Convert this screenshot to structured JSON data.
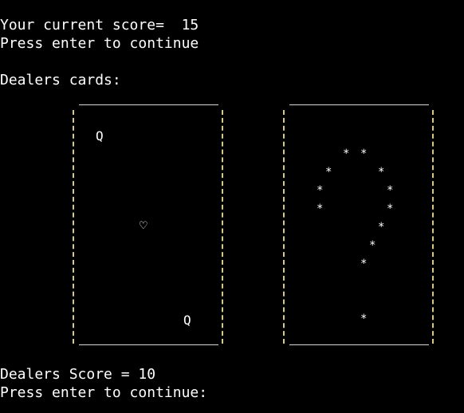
{
  "terminal": {
    "score_line": "Your current score=  15",
    "continue_prompt_1": "Press enter to continue",
    "dealers_cards_label": "Dealers cards:",
    "dealer_score_line": "Dealers Score = 10",
    "continue_prompt_2": "Press enter to continue:"
  },
  "cards": [
    {
      "kind": "face-up",
      "rank_top": "Q",
      "suit": "♡",
      "rank_bottom": "Q"
    },
    {
      "kind": "face-down",
      "pattern_char": "*"
    }
  ],
  "colors": {
    "background": "#000000",
    "text": "#ffffff",
    "card_border_side": "#d7c98a",
    "card_border_top": "#d6d6d6"
  }
}
